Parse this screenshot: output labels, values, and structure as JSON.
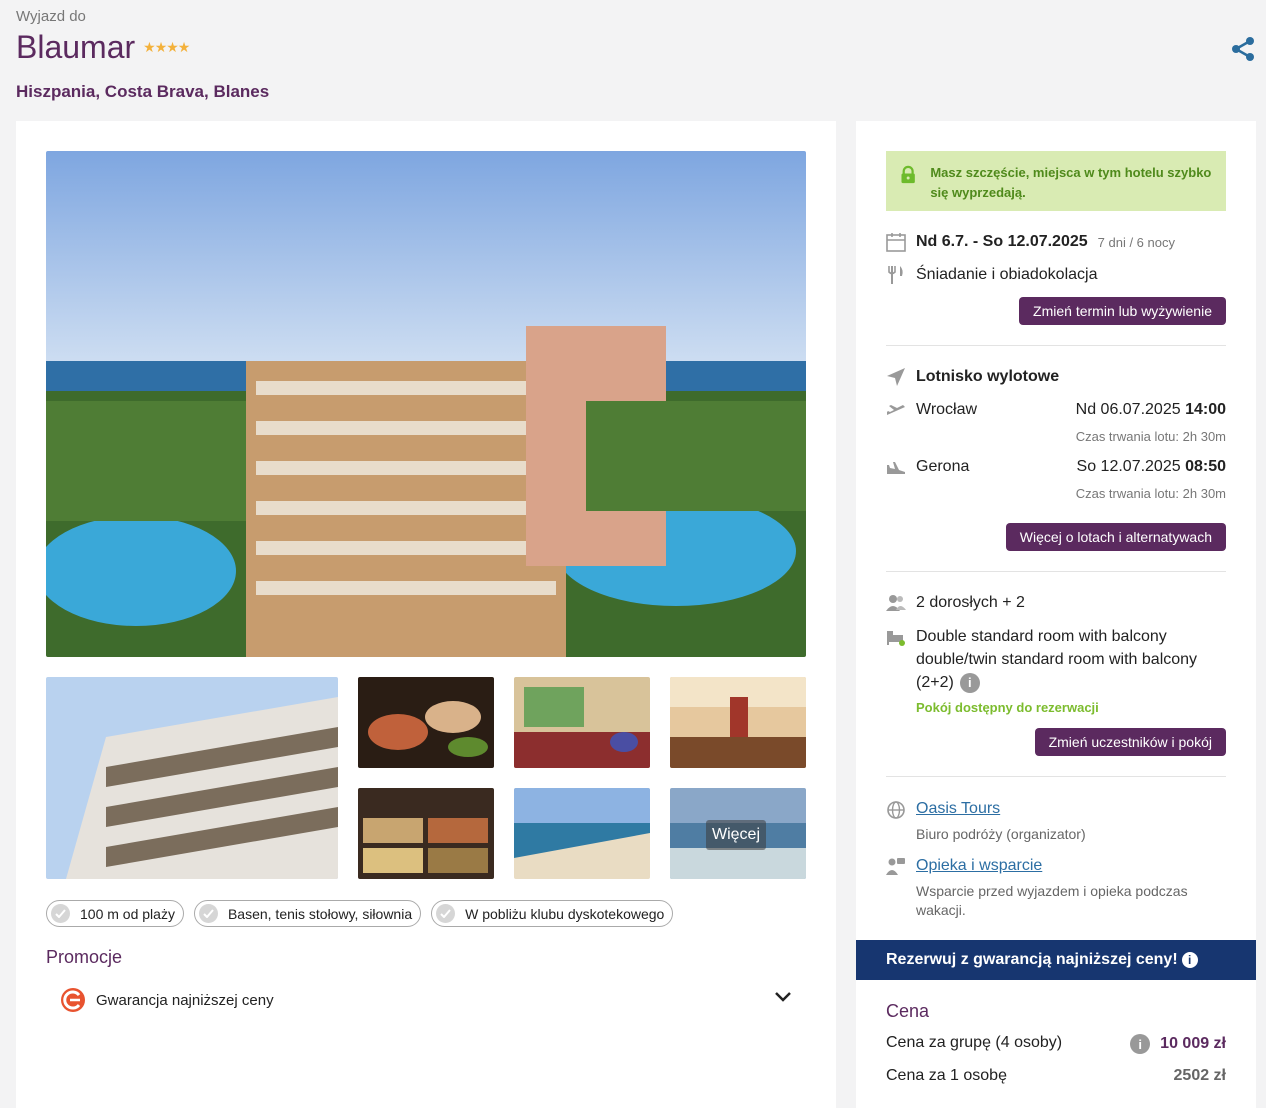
{
  "header": {
    "kicker": "Wyjazd do",
    "hotel_name": "Blaumar",
    "stars": "★★★★",
    "location": "Hiszpania, Costa Brava, Blanes"
  },
  "gallery": {
    "more_label": "Więcej"
  },
  "features": [
    "100 m od plaży",
    "Basen, tenis stołowy, siłownia",
    "W pobliżu klubu dyskotekowego"
  ],
  "promotions": {
    "title": "Promocje",
    "item": "Gwarancja najniższej ceny"
  },
  "booking": {
    "alert": "Masz szczęście, miejsca w tym hotelu szybko się wyprzedają.",
    "dates": "Nd 6.7. - So 12.07.2025",
    "duration": "7 dni / 6 nocy",
    "board": "Śniadanie i obiadokolacja",
    "change_dates_button": "Zmień termin lub wyżywienie",
    "airport_title": "Lotnisko wylotowe",
    "outbound": {
      "city": "Wrocław",
      "date": "Nd 06.07.2025",
      "time": "14:00",
      "duration": "Czas trwania lotu: 2h 30m"
    },
    "inbound": {
      "city": "Gerona",
      "date": "So 12.07.2025",
      "time": "08:50",
      "duration": "Czas trwania lotu: 2h 30m"
    },
    "flights_button": "Więcej o lotach i alternatywach",
    "travellers": "2 dorosłych + 2",
    "room_line1": "Double standard room with balcony",
    "room_line2": "double/twin standard room with balcony",
    "room_line3": "(2+2)",
    "room_available": "Pokój dostępny do rezerwacji",
    "change_room_button": "Zmień uczestników i pokój",
    "organizer_name": "Oasis Tours",
    "organizer_sub": "Biuro podróży (organizator)",
    "support_name": "Opieka i wsparcie",
    "support_sub": "Wsparcie przed wyjazdem i opieka podczas wakacji.",
    "guarantee_bar": "Rezerwuj z gwarancją najniższej ceny!",
    "price_title": "Cena",
    "group_price_label": "Cena za grupę (4 osoby)",
    "group_price": "10 009 zł",
    "person_price_label": "Cena za 1 osobę",
    "person_price": "2502 zł"
  },
  "colors": {
    "brand": "#5b2a5f",
    "alert_bg": "#d9ebb3",
    "navy": "#173670",
    "link": "#2c6ea3"
  }
}
